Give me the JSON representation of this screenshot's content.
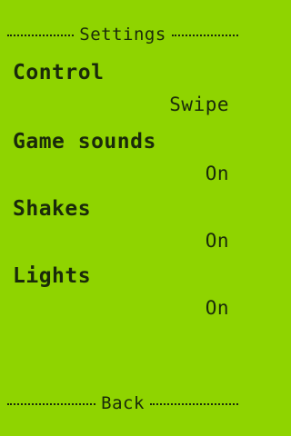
{
  "screen": {
    "title": "Settings",
    "back_label": "Back"
  },
  "settings": [
    {
      "label": "Control",
      "value": "Swipe"
    },
    {
      "label": "Game sounds",
      "value": "On"
    },
    {
      "label": "Shakes",
      "value": "On"
    },
    {
      "label": "Lights",
      "value": "On"
    }
  ],
  "colors": {
    "background": "#8fd400",
    "foreground": "#1a2a0a"
  }
}
